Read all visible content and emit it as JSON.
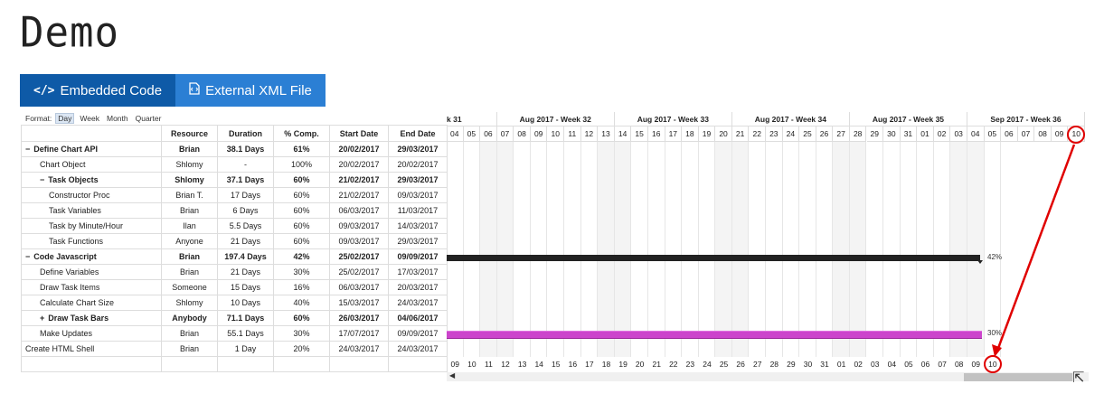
{
  "title": "Demo",
  "tabs": [
    {
      "label": "Embedded Code",
      "icon": "</>",
      "active": true
    },
    {
      "label": "External XML File",
      "icon": "xml-file-icon",
      "active": false
    }
  ],
  "format": {
    "label": "Format:",
    "options": [
      "Day",
      "Week",
      "Month",
      "Quarter"
    ],
    "selected": "Day"
  },
  "columns": [
    "Resource",
    "Duration",
    "% Comp.",
    "Start Date",
    "End Date"
  ],
  "tasks": [
    {
      "toggle": "−",
      "name": "Define Chart API",
      "resource": "Brian",
      "duration": "38.1 Days",
      "comp": "61%",
      "start": "20/02/2017",
      "end": "29/03/2017",
      "group": true,
      "level": 0
    },
    {
      "toggle": "",
      "name": "Chart Object",
      "resource": "Shlomy",
      "duration": "-",
      "comp": "100%",
      "start": "20/02/2017",
      "end": "20/02/2017",
      "group": false,
      "level": 1
    },
    {
      "toggle": "−",
      "name": "Task Objects",
      "resource": "Shlomy",
      "duration": "37.1 Days",
      "comp": "60%",
      "start": "21/02/2017",
      "end": "29/03/2017",
      "group": true,
      "level": 1
    },
    {
      "toggle": "",
      "name": "Constructor Proc",
      "resource": "Brian T.",
      "duration": "17 Days",
      "comp": "60%",
      "start": "21/02/2017",
      "end": "09/03/2017",
      "group": false,
      "level": 2
    },
    {
      "toggle": "",
      "name": "Task Variables",
      "resource": "Brian",
      "duration": "6 Days",
      "comp": "60%",
      "start": "06/03/2017",
      "end": "11/03/2017",
      "group": false,
      "level": 2
    },
    {
      "toggle": "",
      "name": "Task by Minute/Hour",
      "resource": "Ilan",
      "duration": "5.5 Days",
      "comp": "60%",
      "start": "09/03/2017",
      "end": "14/03/2017",
      "group": false,
      "level": 2
    },
    {
      "toggle": "",
      "name": "Task Functions",
      "resource": "Anyone",
      "duration": "21 Days",
      "comp": "60%",
      "start": "09/03/2017",
      "end": "29/03/2017",
      "group": false,
      "level": 2
    },
    {
      "toggle": "−",
      "name": "Code Javascript",
      "resource": "Brian",
      "duration": "197.4 Days",
      "comp": "42%",
      "start": "25/02/2017",
      "end": "09/09/2017",
      "group": true,
      "level": 0
    },
    {
      "toggle": "",
      "name": "Define Variables",
      "resource": "Brian",
      "duration": "21 Days",
      "comp": "30%",
      "start": "25/02/2017",
      "end": "17/03/2017",
      "group": false,
      "level": 1
    },
    {
      "toggle": "",
      "name": "Draw Task Items",
      "resource": "Someone",
      "duration": "15 Days",
      "comp": "16%",
      "start": "06/03/2017",
      "end": "20/03/2017",
      "group": false,
      "level": 1
    },
    {
      "toggle": "",
      "name": "Calculate Chart Size",
      "resource": "Shlomy",
      "duration": "10 Days",
      "comp": "40%",
      "start": "15/03/2017",
      "end": "24/03/2017",
      "group": false,
      "level": 1
    },
    {
      "toggle": "+",
      "name": "Draw Task Bars",
      "resource": "Anybody",
      "duration": "71.1 Days",
      "comp": "60%",
      "start": "26/03/2017",
      "end": "04/06/2017",
      "group": true,
      "level": 1
    },
    {
      "toggle": "",
      "name": "Make Updates",
      "resource": "Brian",
      "duration": "55.1 Days",
      "comp": "30%",
      "start": "17/07/2017",
      "end": "09/09/2017",
      "group": false,
      "level": 1
    },
    {
      "toggle": "",
      "name": "Create HTML Shell",
      "resource": "Brian",
      "duration": "1 Day",
      "comp": "20%",
      "start": "24/03/2017",
      "end": "24/03/2017",
      "group": false,
      "level": 0
    }
  ],
  "gantt": {
    "weeks": [
      "k 31",
      "Aug 2017 - Week 32",
      "Aug 2017 - Week 33",
      "Aug 2017 - Week 34",
      "Aug 2017 - Week 35",
      "Sep 2017 - Week 36"
    ],
    "days": [
      "04",
      "05",
      "06",
      "07",
      "08",
      "09",
      "10",
      "11",
      "12",
      "13",
      "14",
      "15",
      "16",
      "17",
      "18",
      "19",
      "20",
      "21",
      "22",
      "23",
      "24",
      "25",
      "26",
      "27",
      "28",
      "29",
      "30",
      "31",
      "01",
      "02",
      "03",
      "04",
      "05",
      "06",
      "07",
      "08",
      "09",
      "10"
    ],
    "bottom_days": [
      "09",
      "10",
      "11",
      "12",
      "13",
      "14",
      "15",
      "16",
      "17",
      "18",
      "19",
      "20",
      "21",
      "22",
      "23",
      "24",
      "25",
      "26",
      "27",
      "28",
      "29",
      "30",
      "31",
      "01",
      "02",
      "03",
      "04",
      "05",
      "06",
      "07",
      "08",
      "09",
      "10"
    ],
    "bar_labels": {
      "code_javascript": "42%",
      "make_updates": "30%"
    }
  }
}
